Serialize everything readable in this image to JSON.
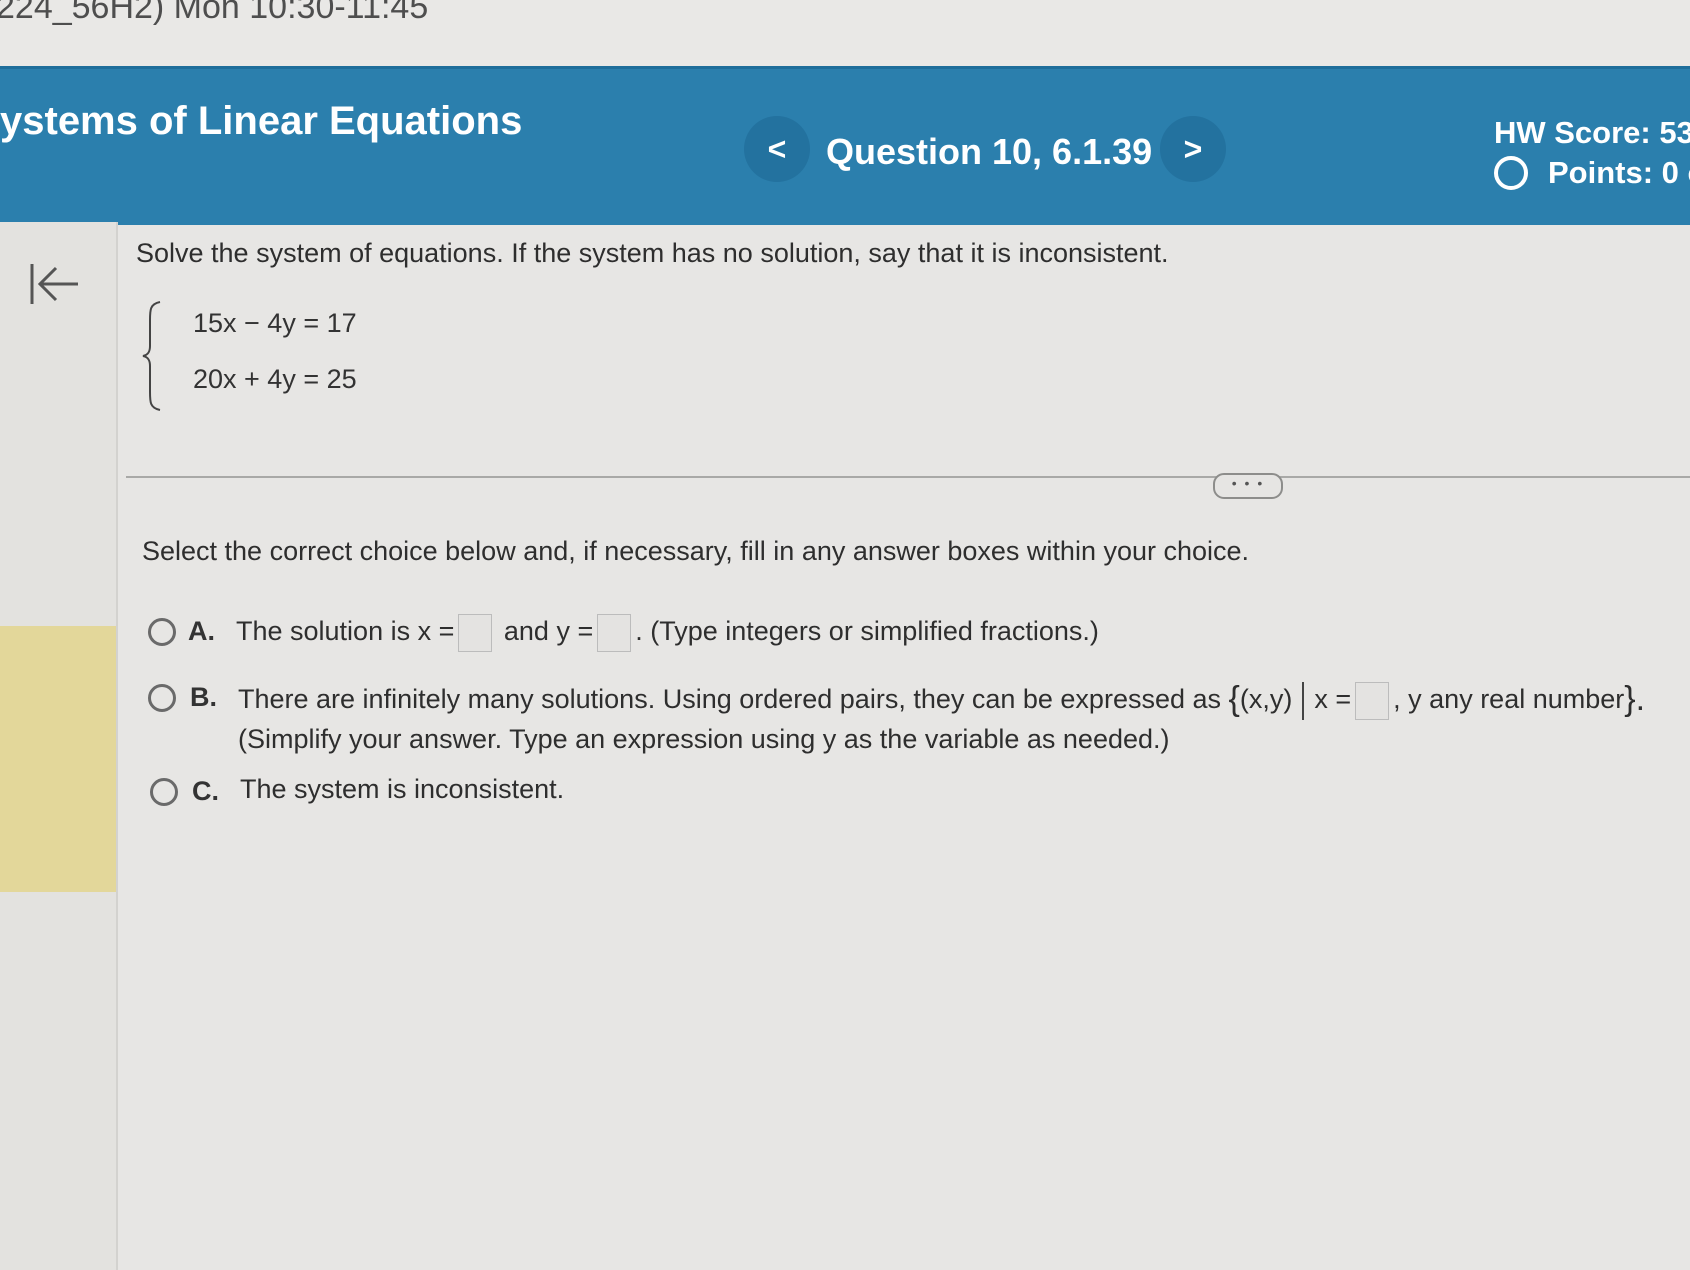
{
  "course_header": "224_56H2) Mon 10:30-11:45",
  "header": {
    "section_title": "ystems of Linear Equations",
    "prev_label": "<",
    "question_title": "Question 10, 6.1.39",
    "next_label": ">",
    "hw_score": "HW Score: 53",
    "points": "Points: 0 c"
  },
  "colors": {
    "header_bg": "#2b7fad",
    "highlight": "#e3d79a"
  },
  "problem": {
    "prompt": "Solve the system of equations. If the system has no solution, say that it is inconsistent.",
    "equations": [
      "15x − 4y = 17",
      "20x + 4y = 25"
    ]
  },
  "more_label": "• • •",
  "instructions": "Select the correct choice below and, if necessary, fill in any answer boxes within your choice.",
  "choices": {
    "a": {
      "letter": "A.",
      "text1": "The solution is x =",
      "text2": "and y =",
      "text3": ". (Type integers or simplified fractions.)"
    },
    "b": {
      "letter": "B.",
      "text1": "There are infinitely many solutions. Using ordered pairs, they can be expressed as",
      "set_open": "{",
      "pair": "(x,y)",
      "x_eq": "x =",
      "text2": ", y any real number",
      "set_close": "}.",
      "text3": "(Simplify your answer. Type an expression using y as the variable as needed.)"
    },
    "c": {
      "letter": "C.",
      "text1": "The system is inconsistent."
    }
  },
  "icons": {
    "collapse": "collapse-left-icon"
  }
}
